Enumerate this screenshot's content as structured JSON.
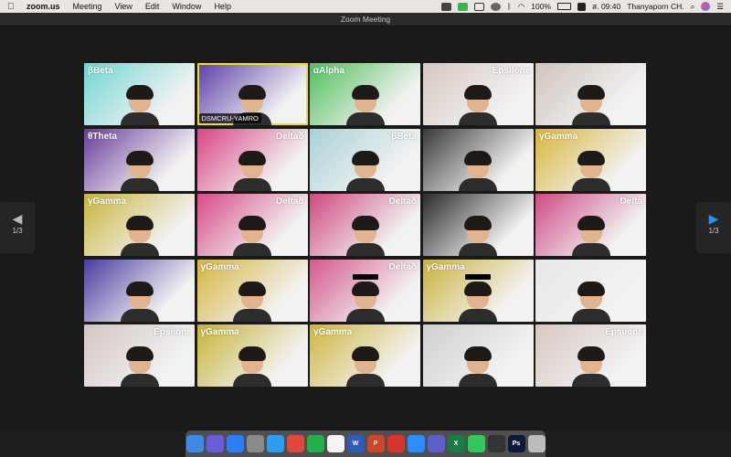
{
  "menubar": {
    "apple_icon": "apple-icon",
    "app_name": "zoom.us",
    "items": [
      "Meeting",
      "View",
      "Edit",
      "Window",
      "Help"
    ],
    "battery": "100%",
    "clock": "ส. 09:40",
    "user": "Thanyaporn CH."
  },
  "window": {
    "title": "Zoom Meeting"
  },
  "pager": {
    "prev": "1/3",
    "next": "1/3"
  },
  "tiles": [
    {
      "label": "βBeta",
      "bg": "#6fd6d2",
      "side": "left"
    },
    {
      "label": "",
      "bg": "#5a3ea8",
      "name": "DSMCRU-YAMRO",
      "active": true
    },
    {
      "label": "αAlpha",
      "bg": "#4fbf5a",
      "side": "left"
    },
    {
      "label": "Epsilonε",
      "bg": "#d7c8c2",
      "side": "right"
    },
    {
      "label": "",
      "bg": "#cfc4bd"
    },
    {
      "label": "θTheta",
      "bg": "#6a3c9a",
      "side": "left"
    },
    {
      "label": "Deltaδ",
      "bg": "#d94583",
      "side": "right"
    },
    {
      "label": "βBeta",
      "bg": "#a8d2d6",
      "side": "right"
    },
    {
      "label": "",
      "bg": "#3a3a3a"
    },
    {
      "label": "γGamma",
      "bg": "#d9b53a",
      "side": "left"
    },
    {
      "label": "γGamma",
      "bg": "#c8b43c",
      "side": "left"
    },
    {
      "label": "Deltaδ",
      "bg": "#d84b86",
      "side": "right"
    },
    {
      "label": "Deltaδ",
      "bg": "#cf4980",
      "side": "right"
    },
    {
      "label": "",
      "bg": "#2a2a2a"
    },
    {
      "label": "Delta",
      "bg": "#cf4a85",
      "side": "right"
    },
    {
      "label": "",
      "bg": "#4a3ca0"
    },
    {
      "label": "γGamma",
      "bg": "#d6b43e",
      "side": "left"
    },
    {
      "label": "Deltaδ",
      "bg": "#d6578c",
      "side": "right",
      "sunglasses": true
    },
    {
      "label": "γGamma",
      "bg": "#cbb23a",
      "side": "left",
      "sunglasses": true
    },
    {
      "label": "",
      "bg": "#e8e8ea"
    },
    {
      "label": "Epsilonε",
      "bg": "#d2c6c2",
      "side": "right"
    },
    {
      "label": "γGamma",
      "bg": "#c5b336",
      "side": "left"
    },
    {
      "label": "γGamma",
      "bg": "#cfb53c",
      "side": "left"
    },
    {
      "label": "",
      "bg": "#cfcfcf"
    },
    {
      "label": "Epsilonε",
      "bg": "#d6c7c1",
      "side": "right"
    }
  ],
  "dock": [
    {
      "icon": "finder-icon",
      "color": "#3e8ae6",
      "text": ""
    },
    {
      "icon": "siri-icon",
      "color": "#6a5bd6",
      "text": ""
    },
    {
      "icon": "appstore-icon",
      "color": "#2b7ff0",
      "text": ""
    },
    {
      "icon": "settings-icon",
      "color": "#8a8a8a",
      "text": ""
    },
    {
      "icon": "safari-icon",
      "color": "#2f9cf0",
      "text": ""
    },
    {
      "icon": "chrome-icon",
      "color": "#e0483c",
      "text": ""
    },
    {
      "icon": "line-icon",
      "color": "#21b14c",
      "text": ""
    },
    {
      "icon": "calendar-icon",
      "color": "#f4f4f4",
      "text": ""
    },
    {
      "icon": "word-icon",
      "color": "#2d5bb8",
      "text": "W"
    },
    {
      "icon": "powerpoint-icon",
      "color": "#c9472b",
      "text": "P"
    },
    {
      "icon": "acrobat-icon",
      "color": "#d3362b",
      "text": ""
    },
    {
      "icon": "zoom-icon",
      "color": "#2d8cff",
      "text": ""
    },
    {
      "icon": "teams-icon",
      "color": "#5b5fc7",
      "text": ""
    },
    {
      "icon": "excel-icon",
      "color": "#1d7a45",
      "text": "X"
    },
    {
      "icon": "facetime-icon",
      "color": "#34c759",
      "text": ""
    },
    {
      "icon": "activity-icon",
      "color": "#333333",
      "text": ""
    },
    {
      "icon": "photoshop-icon",
      "color": "#0d1b38",
      "text": "Ps"
    },
    {
      "icon": "trash-icon",
      "color": "#bcbcbc",
      "text": ""
    }
  ]
}
